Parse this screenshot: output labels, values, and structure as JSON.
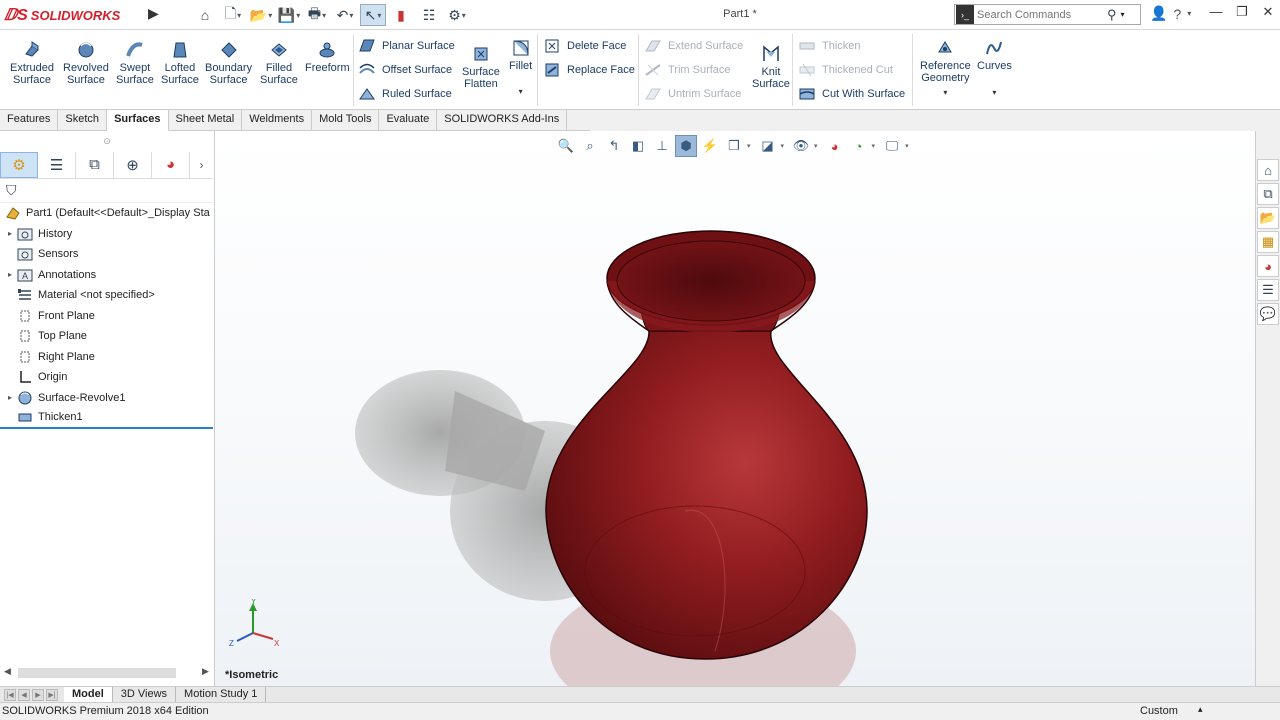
{
  "app": {
    "logo_text": "SOLIDWORKS",
    "document_title": "Part1 *",
    "search_placeholder": "Search Commands"
  },
  "ribbon": {
    "large_tools": [
      {
        "label": "Extruded\nSurface",
        "icon": "extruded-surface-icon"
      },
      {
        "label": "Revolved\nSurface",
        "icon": "revolved-surface-icon"
      },
      {
        "label": "Swept\nSurface",
        "icon": "swept-surface-icon"
      },
      {
        "label": "Lofted\nSurface",
        "icon": "lofted-surface-icon"
      },
      {
        "label": "Boundary\nSurface",
        "icon": "boundary-surface-icon"
      },
      {
        "label": "Filled\nSurface",
        "icon": "filled-surface-icon"
      },
      {
        "label": "Freeform",
        "icon": "freeform-icon"
      }
    ],
    "planar_surface": "Planar Surface",
    "offset_surface": "Offset Surface",
    "ruled_surface": "Ruled Surface",
    "surface_flatten": "Surface\nFlatten",
    "fillet": "Fillet",
    "delete_face": "Delete Face",
    "replace_face": "Replace Face",
    "extend_surface": "Extend Surface",
    "trim_surface": "Trim Surface",
    "untrim_surface": "Untrim Surface",
    "knit_surface": "Knit\nSurface",
    "thicken": "Thicken",
    "thickened_cut": "Thickened Cut",
    "cut_with_surface": "Cut With Surface",
    "reference_geometry": "Reference\nGeometry",
    "curves": "Curves"
  },
  "tabs": [
    "Features",
    "Sketch",
    "Surfaces",
    "Sheet Metal",
    "Weldments",
    "Mold Tools",
    "Evaluate",
    "SOLIDWORKS Add-Ins"
  ],
  "active_tab": "Surfaces",
  "tree": {
    "root": "Part1  (Default<<Default>_Display Sta",
    "items": [
      {
        "label": "History",
        "icon": "history-folder-icon",
        "expandable": true
      },
      {
        "label": "Sensors",
        "icon": "sensors-icon",
        "expandable": false
      },
      {
        "label": "Annotations",
        "icon": "annotations-icon",
        "expandable": true
      },
      {
        "label": "Material <not specified>",
        "icon": "material-icon",
        "expandable": false
      },
      {
        "label": "Front Plane",
        "icon": "plane-icon",
        "expandable": false
      },
      {
        "label": "Top Plane",
        "icon": "plane-icon",
        "expandable": false
      },
      {
        "label": "Right Plane",
        "icon": "plane-icon",
        "expandable": false
      },
      {
        "label": "Origin",
        "icon": "origin-icon",
        "expandable": false
      },
      {
        "label": "Surface-Revolve1",
        "icon": "surface-revolve-icon",
        "expandable": true
      },
      {
        "label": "Thicken1",
        "icon": "thicken-feature-icon",
        "expandable": false
      }
    ]
  },
  "viewport": {
    "view_label": "*Isometric",
    "triad": {
      "x": "X",
      "y": "Y",
      "z": "Z"
    }
  },
  "bottom_tabs": [
    "Model",
    "3D Views",
    "Motion Study 1"
  ],
  "active_bottom_tab": "Model",
  "status": {
    "edition": "SOLIDWORKS Premium 2018 x64 Edition",
    "units": "Custom"
  },
  "colors": {
    "vase": "#7a1518",
    "accent": "#2b7cd3",
    "brand": "#d4202a"
  }
}
